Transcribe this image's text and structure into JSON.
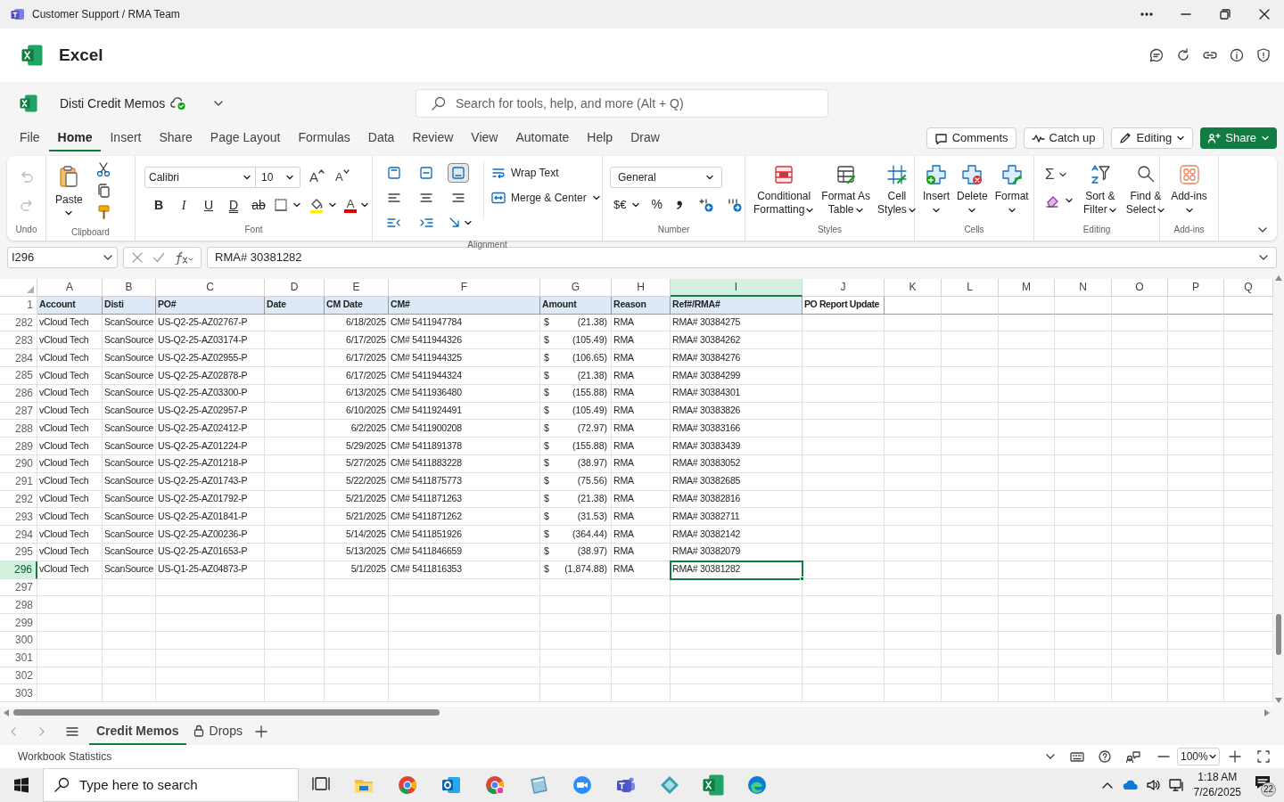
{
  "title_bar": {
    "title": "Customer Support / RMA Team"
  },
  "app_header": {
    "app_name": "Excel"
  },
  "document": {
    "name": "Disti Credit Memos"
  },
  "search": {
    "placeholder": "Search for tools, help, and more (Alt + Q)"
  },
  "menu_tabs": [
    {
      "label": "File",
      "selected": false
    },
    {
      "label": "Home",
      "selected": true
    },
    {
      "label": "Insert",
      "selected": false
    },
    {
      "label": "Share",
      "selected": false
    },
    {
      "label": "Page Layout",
      "selected": false
    },
    {
      "label": "Formulas",
      "selected": false
    },
    {
      "label": "Data",
      "selected": false
    },
    {
      "label": "Review",
      "selected": false
    },
    {
      "label": "View",
      "selected": false
    },
    {
      "label": "Automate",
      "selected": false
    },
    {
      "label": "Help",
      "selected": false
    },
    {
      "label": "Draw",
      "selected": false
    }
  ],
  "header_buttons": [
    {
      "kind": "comments",
      "label": "Comments"
    },
    {
      "kind": "catchup",
      "label": "Catch up"
    },
    {
      "kind": "editing",
      "label": "Editing"
    },
    {
      "kind": "share",
      "label": "Share"
    }
  ],
  "ribbon": {
    "undo_group": {
      "label": "Undo",
      "undo_disabled": true,
      "redo_disabled": true
    },
    "clipboard": {
      "label": "Clipboard",
      "paste": "Paste"
    },
    "font": {
      "label": "Font",
      "family": "Calibri",
      "size": "10",
      "grow": "A",
      "shrink": "A",
      "font_color": "A",
      "styles": [
        {
          "kind": "bold",
          "label": "B"
        },
        {
          "kind": "italic",
          "label": "I"
        },
        {
          "kind": "underline",
          "label": "U"
        },
        {
          "kind": "double_underline",
          "label": "D"
        },
        {
          "kind": "strike",
          "label": "ab"
        }
      ]
    },
    "alignment": {
      "label": "Alignment",
      "vertical": [
        {
          "selected": false
        },
        {
          "selected": false
        },
        {
          "selected": true
        }
      ],
      "wrap": "Wrap Text",
      "merge": "Merge & Center"
    },
    "number": {
      "label": "Number",
      "format": "General",
      "currency": "$€",
      "percent": "%"
    },
    "styles": {
      "label": "Styles",
      "buttons": [
        {
          "kind": "conditional",
          "lines": [
            "Conditional",
            "Formatting"
          ]
        },
        {
          "kind": "table",
          "lines": [
            "Format As",
            "Table"
          ]
        },
        {
          "kind": "cell",
          "lines": [
            "Cell",
            "Styles"
          ]
        }
      ]
    },
    "cells": {
      "label": "Cells",
      "buttons": [
        {
          "kind": "insert",
          "label": "Insert"
        },
        {
          "kind": "delete",
          "label": "Delete"
        },
        {
          "kind": "format",
          "label": "Format"
        }
      ]
    },
    "editing": {
      "label": "Editing",
      "autosum": "Σ",
      "buttons": [
        {
          "kind": "sort",
          "lines": [
            "Sort &",
            "Filter"
          ]
        },
        {
          "kind": "find",
          "lines": [
            "Find &",
            "Select"
          ]
        }
      ]
    },
    "addins": {
      "label": "Add-ins",
      "button": "Add-ins"
    }
  },
  "formula_bar": {
    "name_box": "I296",
    "formula": "RMA# 30381282"
  },
  "sheet": {
    "columns": [
      {
        "letter": "A",
        "selected": false
      },
      {
        "letter": "B",
        "selected": false
      },
      {
        "letter": "C",
        "selected": false
      },
      {
        "letter": "D",
        "selected": false
      },
      {
        "letter": "E",
        "selected": false
      },
      {
        "letter": "F",
        "selected": false
      },
      {
        "letter": "G",
        "selected": false
      },
      {
        "letter": "H",
        "selected": false
      },
      {
        "letter": "I",
        "selected": true
      },
      {
        "letter": "J",
        "selected": false
      },
      {
        "letter": "K",
        "selected": false
      },
      {
        "letter": "L",
        "selected": false
      },
      {
        "letter": "M",
        "selected": false
      },
      {
        "letter": "N",
        "selected": false
      },
      {
        "letter": "O",
        "selected": false
      },
      {
        "letter": "P",
        "selected": false
      },
      {
        "letter": "Q",
        "selected": false
      }
    ],
    "header_row": {
      "num": "1",
      "cells": [
        "Account",
        "Disti",
        "PO#",
        "Date",
        "CM Date",
        "CM#",
        "Amount",
        "Reason",
        "Ref#/RMA#",
        "PO Report Update"
      ]
    },
    "rows": [
      {
        "num": "282",
        "selected": false,
        "account": "vCloud Tech",
        "disti": "ScanSource",
        "po": "US-Q2-25-AZ02767-P",
        "cm_date": "6/18/2025",
        "cm": "CM# 5411947784",
        "currency": "$",
        "amount": "(21.38)",
        "reason": "RMA",
        "ref": "RMA# 30384275"
      },
      {
        "num": "283",
        "selected": false,
        "account": "vCloud Tech",
        "disti": "ScanSource",
        "po": "US-Q2-25-AZ03174-P",
        "cm_date": "6/17/2025",
        "cm": "CM# 5411944326",
        "currency": "$",
        "amount": "(105.49)",
        "reason": "RMA",
        "ref": "RMA# 30384262"
      },
      {
        "num": "284",
        "selected": false,
        "account": "vCloud Tech",
        "disti": "ScanSource",
        "po": "US-Q2-25-AZ02955-P",
        "cm_date": "6/17/2025",
        "cm": "CM# 5411944325",
        "currency": "$",
        "amount": "(106.65)",
        "reason": "RMA",
        "ref": "RMA# 30384276"
      },
      {
        "num": "285",
        "selected": false,
        "account": "vCloud Tech",
        "disti": "ScanSource",
        "po": "US-Q2-25-AZ02878-P",
        "cm_date": "6/17/2025",
        "cm": "CM# 5411944324",
        "currency": "$",
        "amount": "(21.38)",
        "reason": "RMA",
        "ref": "RMA# 30384299"
      },
      {
        "num": "286",
        "selected": false,
        "account": "vCloud Tech",
        "disti": "ScanSource",
        "po": "US-Q2-25-AZ03300-P",
        "cm_date": "6/13/2025",
        "cm": "CM# 5411936480",
        "currency": "$",
        "amount": "(155.88)",
        "reason": "RMA",
        "ref": "RMA# 30384301"
      },
      {
        "num": "287",
        "selected": false,
        "account": "vCloud Tech",
        "disti": "ScanSource",
        "po": "US-Q2-25-AZ02957-P",
        "cm_date": "6/10/2025",
        "cm": "CM# 5411924491",
        "currency": "$",
        "amount": "(105.49)",
        "reason": "RMA",
        "ref": "RMA# 30383826"
      },
      {
        "num": "288",
        "selected": false,
        "account": "vCloud Tech",
        "disti": "ScanSource",
        "po": "US-Q2-25-AZ02412-P",
        "cm_date": "6/2/2025",
        "cm": "CM# 5411900208",
        "currency": "$",
        "amount": "(72.97)",
        "reason": "RMA",
        "ref": "RMA# 30383166"
      },
      {
        "num": "289",
        "selected": false,
        "account": "vCloud Tech",
        "disti": "ScanSource",
        "po": "US-Q2-25-AZ01224-P",
        "cm_date": "5/29/2025",
        "cm": "CM# 5411891378",
        "currency": "$",
        "amount": "(155.88)",
        "reason": "RMA",
        "ref": "RMA# 30383439"
      },
      {
        "num": "290",
        "selected": false,
        "account": "vCloud Tech",
        "disti": "ScanSource",
        "po": "US-Q2-25-AZ01218-P",
        "cm_date": "5/27/2025",
        "cm": "CM# 5411883228",
        "currency": "$",
        "amount": "(38.97)",
        "reason": "RMA",
        "ref": "RMA# 30383052"
      },
      {
        "num": "291",
        "selected": false,
        "account": "vCloud Tech",
        "disti": "ScanSource",
        "po": "US-Q2-25-AZ01743-P",
        "cm_date": "5/22/2025",
        "cm": "CM# 5411875773",
        "currency": "$",
        "amount": "(75.56)",
        "reason": "RMA",
        "ref": "RMA# 30382685"
      },
      {
        "num": "292",
        "selected": false,
        "account": "vCloud Tech",
        "disti": "ScanSource",
        "po": "US-Q2-25-AZ01792-P",
        "cm_date": "5/21/2025",
        "cm": "CM# 5411871263",
        "currency": "$",
        "amount": "(21.38)",
        "reason": "RMA",
        "ref": "RMA# 30382816"
      },
      {
        "num": "293",
        "selected": false,
        "account": "vCloud Tech",
        "disti": "ScanSource",
        "po": "US-Q2-25-AZ01841-P",
        "cm_date": "5/21/2025",
        "cm": "CM# 5411871262",
        "currency": "$",
        "amount": "(31.53)",
        "reason": "RMA",
        "ref": "RMA# 30382711"
      },
      {
        "num": "294",
        "selected": false,
        "account": "vCloud Tech",
        "disti": "ScanSource",
        "po": "US-Q2-25-AZ00236-P",
        "cm_date": "5/14/2025",
        "cm": "CM# 5411851926",
        "currency": "$",
        "amount": "(364.44)",
        "reason": "RMA",
        "ref": "RMA# 30382142"
      },
      {
        "num": "295",
        "selected": false,
        "account": "vCloud Tech",
        "disti": "ScanSource",
        "po": "US-Q2-25-AZ01653-P",
        "cm_date": "5/13/2025",
        "cm": "CM# 5411846659",
        "currency": "$",
        "amount": "(38.97)",
        "reason": "RMA",
        "ref": "RMA# 30382079"
      },
      {
        "num": "296",
        "selected": true,
        "account": "vCloud Tech",
        "disti": "ScanSource",
        "po": "US-Q1-25-AZ04873-P",
        "cm_date": "5/1/2025",
        "cm": "CM# 5411816353",
        "currency": "$",
        "amount": "(1,874.88)",
        "reason": "RMA",
        "ref": "RMA# 30381282"
      },
      {
        "num": "297",
        "selected": false
      },
      {
        "num": "298",
        "selected": false
      },
      {
        "num": "299",
        "selected": false
      },
      {
        "num": "300",
        "selected": false
      },
      {
        "num": "301",
        "selected": false
      },
      {
        "num": "302",
        "selected": false
      },
      {
        "num": "303",
        "selected": false
      }
    ]
  },
  "sheet_tabs": [
    {
      "label": "Credit Memos",
      "selected": true,
      "locked": false
    },
    {
      "label": "Drops",
      "selected": false,
      "locked": true
    }
  ],
  "status_bar": {
    "left": "Workbook Statistics",
    "zoom": "100%"
  },
  "taskbar": {
    "search_placeholder": "Type here to search",
    "time": "1:18 AM",
    "date": "7/26/2025",
    "notifications": "22"
  }
}
